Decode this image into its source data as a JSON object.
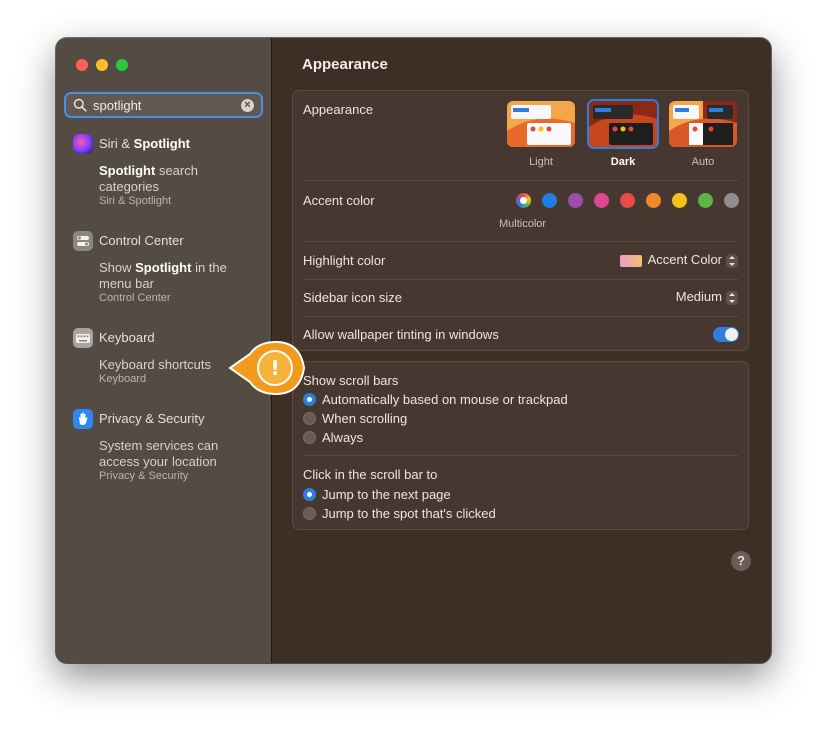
{
  "search": {
    "value": "spotlight"
  },
  "sidebar": {
    "results": [
      {
        "title_pre": "Siri & ",
        "title_bold": "Spotlight",
        "title_post": "",
        "result_bold": "Spotlight",
        "result_rest": " search categories",
        "sub": "Siri & Spotlight",
        "icon": "siri-icon"
      },
      {
        "title_pre": "Control Center",
        "title_bold": "",
        "title_post": "",
        "result_pre": "Show ",
        "result_bold": "Spotlight",
        "result_rest": " in the menu bar",
        "sub": "Control Center",
        "icon": "control-center-icon"
      },
      {
        "title_pre": "Keyboard",
        "title_bold": "",
        "title_post": "",
        "result_rest": "Keyboard shortcuts",
        "sub": "Keyboard",
        "icon": "keyboard-icon"
      },
      {
        "title_pre": "Privacy & Security",
        "title_bold": "",
        "title_post": "",
        "result_rest": "System services can access your location",
        "sub": "Privacy & Security",
        "icon": "hand-icon"
      }
    ]
  },
  "main": {
    "title": "Appearance",
    "appearance": {
      "label": "Appearance",
      "options": [
        {
          "label": "Light",
          "selected": false
        },
        {
          "label": "Dark",
          "selected": true
        },
        {
          "label": "Auto",
          "selected": false
        }
      ]
    },
    "accent": {
      "label": "Accent color",
      "selected_label": "Multicolor",
      "colors": [
        "multicolor",
        "#1f7ee6",
        "#9a4fb0",
        "#e0458f",
        "#e84a4a",
        "#f08a28",
        "#f5c21a",
        "#5cb54a",
        "#8e8e8e"
      ]
    },
    "highlight": {
      "label": "Highlight color",
      "value": "Accent Color"
    },
    "sidebar_icon_size": {
      "label": "Sidebar icon size",
      "value": "Medium"
    },
    "wallpaper_tinting": {
      "label": "Allow wallpaper tinting in windows",
      "on": true
    },
    "scroll_bars": {
      "label": "Show scroll bars",
      "options": [
        {
          "label": "Automatically based on mouse or trackpad",
          "selected": true
        },
        {
          "label": "When scrolling",
          "selected": false
        },
        {
          "label": "Always",
          "selected": false
        }
      ]
    },
    "click_scroll": {
      "label": "Click in the scroll bar to",
      "options": [
        {
          "label": "Jump to the next page",
          "selected": true
        },
        {
          "label": "Jump to the spot that's clicked",
          "selected": false
        }
      ]
    },
    "help_label": "?"
  },
  "callout": {
    "symbol": "!",
    "color": "#f29a1c"
  }
}
